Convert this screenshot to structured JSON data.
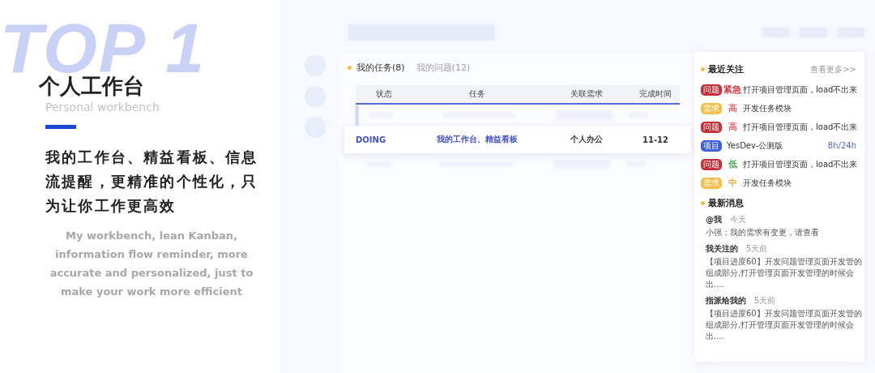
{
  "hero": {
    "watermark": "TOP 1",
    "title": "个人工作台",
    "subtitle": "Personal workbench",
    "description": "我的工作台、精益看板、信息流提醒，更精准的个性化，只为让你工作更高效",
    "description_en": "My workbench, lean Kanban, information flow reminder, more accurate and personalized, just to make your work more efficient"
  },
  "tabs": [
    {
      "label": "我的任务(8)",
      "selected": true
    },
    {
      "label": "我的问题(12)",
      "selected": false
    }
  ],
  "table": {
    "columns": [
      "状态",
      "任务",
      "关联需求",
      "完成时间"
    ],
    "focused_row": {
      "status": "DOING",
      "task": "我的工作台、精益看板",
      "requirement": "个人办公",
      "due": "11-12"
    }
  },
  "follows": {
    "title": "最近关注",
    "more": "查看更多>>",
    "items": [
      {
        "kind": "issue",
        "tag": "问题",
        "color": "#c62f36",
        "priority": {
          "label": "紧急",
          "color": "#d9363e"
        },
        "text": "打开项目管理页面，load不出来"
      },
      {
        "kind": "issue",
        "tag": "需求",
        "color": "#f5c04a",
        "priority": {
          "label": "高",
          "color": "#e0707a"
        },
        "text": "开发任务模块"
      },
      {
        "kind": "issue",
        "tag": "问题",
        "color": "#c62f36",
        "priority": {
          "label": "高",
          "color": "#e0707a"
        },
        "text": "打开项目管理页面，load不出来"
      },
      {
        "kind": "project",
        "tag": "项目",
        "color": "#3d5fe0",
        "text": "YesDev-公测版",
        "hours": "8h/24h"
      },
      {
        "kind": "issue",
        "tag": "问题",
        "color": "#c62f36",
        "priority": {
          "label": "低",
          "color": "#4caf50"
        },
        "text": "打开项目管理页面，load不出来"
      },
      {
        "kind": "issue",
        "tag": "需求",
        "color": "#f5c04a",
        "priority": {
          "label": "中",
          "color": "#e8a93a"
        },
        "text": "开发任务模块"
      }
    ]
  },
  "messages": {
    "title": "最新消息",
    "items": [
      {
        "from": "@我",
        "time": "今天",
        "text": "小强：我的需求有变更，请查看"
      },
      {
        "from": "我关注的",
        "time": "5天前",
        "text": "【项目进度60】开发问题管理页面开发管的组成部分,打开管理页面开发管理的时候会出...."
      },
      {
        "from": "指派给我的",
        "time": "5天前",
        "text": "【项目进度60】开发问题管理页面开发管的组成部分,打开管理页面开发管理的时候会出...."
      }
    ]
  }
}
